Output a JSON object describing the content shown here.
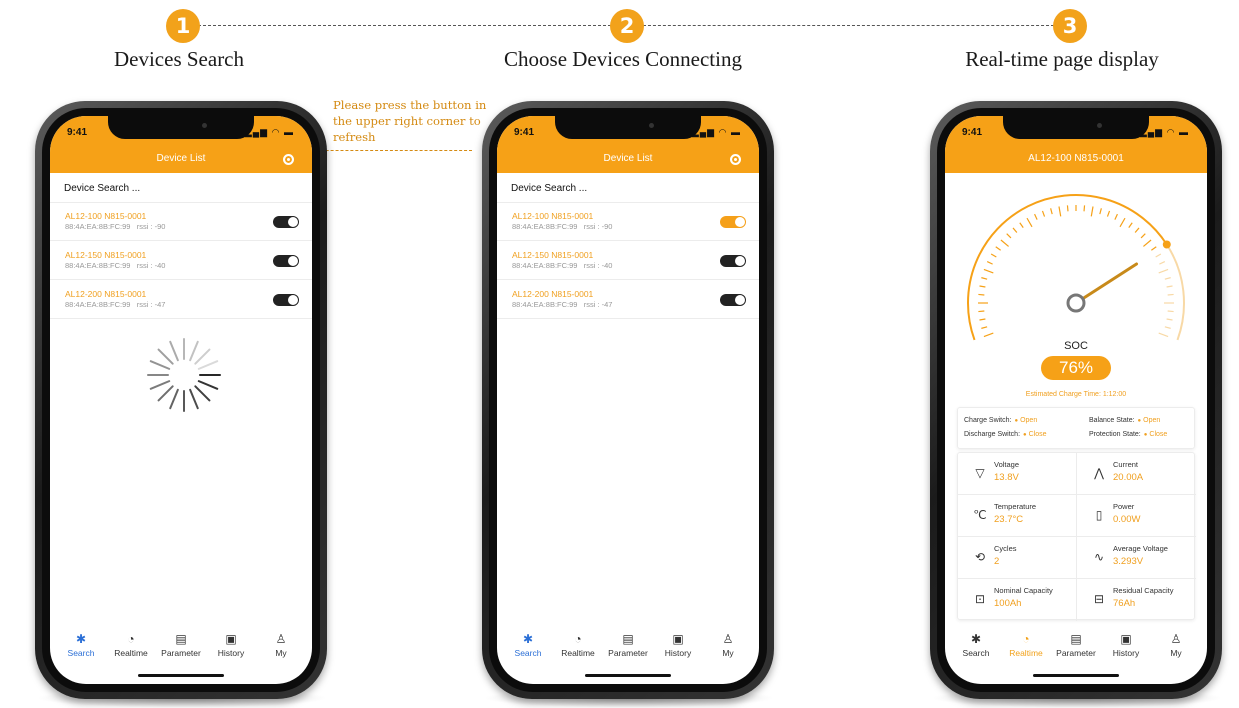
{
  "steps": [
    {
      "number": "1",
      "title": "Devices Search"
    },
    {
      "number": "2",
      "title": "Choose Devices Connecting"
    },
    {
      "number": "3",
      "title": "Real-time page display"
    }
  ],
  "callout": {
    "text": "Please press the button in the upper right corner to refresh"
  },
  "status_bar": {
    "time": "9:41"
  },
  "colors": {
    "accent": "#f6a117",
    "active_tab": "#2b6fd6",
    "toggle_off": "#222222"
  },
  "list_screen": {
    "title": "Device List",
    "search_label": "Device Search ...",
    "devices": [
      {
        "name": "AL12-100 N815-0001",
        "mac": "88:4A:EA:8B:FC:99",
        "rssi": "rssi : -90"
      },
      {
        "name": "AL12-150 N815-0001",
        "mac": "88:4A:EA:8B:FC:99",
        "rssi": "rssi : -40"
      },
      {
        "name": "AL12-200 N815-0001",
        "mac": "88:4A:EA:8B:FC:99",
        "rssi": "rssi : -47"
      }
    ]
  },
  "phone1": {
    "toggles_on": [
      false,
      false,
      false
    ],
    "loading": true
  },
  "phone2": {
    "toggles_on": [
      true,
      false,
      false
    ]
  },
  "realtime_screen": {
    "title": "AL12-100 N815-0001",
    "soc_label": "SOC",
    "soc_value": "76%",
    "soc_fraction": 0.76,
    "charge_time": "Estimated Charge Time: 1:12:00",
    "states": [
      {
        "label": "Charge Switch:",
        "value": "Open"
      },
      {
        "label": "Balance State:",
        "value": "Open"
      },
      {
        "label": "Discharge Switch:",
        "value": "Close"
      },
      {
        "label": "Protection State:",
        "value": "Close"
      }
    ],
    "metrics": [
      {
        "icon": "voltage-icon",
        "label": "Voltage",
        "value": "13.8V"
      },
      {
        "icon": "current-icon",
        "label": "Current",
        "value": "20.00A"
      },
      {
        "icon": "temperature-icon",
        "label": "Temperature",
        "value": "23.7°C"
      },
      {
        "icon": "power-icon",
        "label": "Power",
        "value": "0.00W"
      },
      {
        "icon": "cycles-icon",
        "label": "Cycles",
        "value": "2"
      },
      {
        "icon": "average-voltage-icon",
        "label": "Average Voltage",
        "value": "3.293V"
      },
      {
        "icon": "nominal-capacity-icon",
        "label": "Nominal Capacity",
        "value": "100Ah"
      },
      {
        "icon": "residual-capacity-icon",
        "label": "Residual Capacity",
        "value": "76Ah"
      }
    ]
  },
  "tabs": [
    {
      "label": "Search",
      "icon": "bluetooth-icon"
    },
    {
      "label": "Realtime",
      "icon": "realtime-gauge-icon"
    },
    {
      "label": "Parameter",
      "icon": "parameter-chart-icon"
    },
    {
      "label": "History",
      "icon": "history-chart-icon"
    },
    {
      "label": "My",
      "icon": "profile-icon"
    }
  ]
}
